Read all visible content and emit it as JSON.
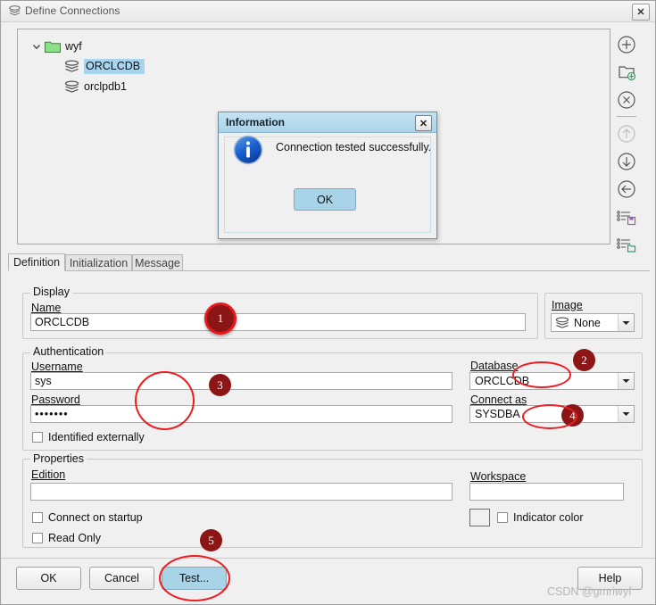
{
  "window": {
    "title": "Define Connections",
    "title_icon": "database-stack-icon",
    "close_label": "✕"
  },
  "tree": {
    "nodes": [
      {
        "label": "wyf",
        "icon": "folder-icon",
        "expander": "chevron-down-icon",
        "selected": false,
        "level": 0
      },
      {
        "label": "ORCLCDB",
        "icon": "database-stack-icon",
        "selected": true,
        "level": 1
      },
      {
        "label": "orclpdb1",
        "icon": "database-stack-icon",
        "selected": false,
        "level": 1
      }
    ]
  },
  "toolbar": {
    "buttons": [
      {
        "name": "add-connection-button",
        "icon": "plus-circle-icon",
        "enabled": true
      },
      {
        "name": "new-folder-button",
        "icon": "folder-add-icon",
        "enabled": true
      },
      {
        "name": "delete-connection-button",
        "icon": "x-circle-icon",
        "enabled": true
      },
      {
        "name": "move-up-button",
        "icon": "arrow-up-circle-icon",
        "enabled": false
      },
      {
        "name": "move-down-button",
        "icon": "arrow-down-circle-icon",
        "enabled": true
      },
      {
        "name": "move-back-button",
        "icon": "arrow-left-circle-icon",
        "enabled": true
      },
      {
        "name": "export-list-button",
        "icon": "list-save-icon",
        "enabled": true
      },
      {
        "name": "import-list-button",
        "icon": "list-open-icon",
        "enabled": true
      }
    ]
  },
  "tabs": [
    {
      "label": "Definition",
      "active": true
    },
    {
      "label": "Initialization",
      "active": false
    },
    {
      "label": "Message",
      "active": false
    }
  ],
  "display_group": {
    "title": "Display",
    "name_label": "Name",
    "name_value": "ORCLCDB",
    "image_label": "Image",
    "image_value": "None",
    "image_icon": "database-stack-icon"
  },
  "authentication_group": {
    "title": "Authentication",
    "username_label": "Username",
    "username_value": "sys",
    "password_label": "Password",
    "password_value": "•••••••",
    "identified_externally_label": "Identified externally",
    "identified_externally_checked": false,
    "database_label": "Database",
    "database_value": "ORCLCDB",
    "connect_as_label": "Connect as",
    "connect_as_value": "SYSDBA"
  },
  "properties_group": {
    "title": "Properties",
    "edition_label": "Edition",
    "edition_value": "",
    "connect_on_startup_label": "Connect on startup",
    "connect_on_startup_checked": false,
    "read_only_label": "Read Only",
    "read_only_checked": false,
    "workspace_label": "Workspace",
    "workspace_value": "",
    "indicator_color_label": "Indicator color",
    "indicator_color_checked": false,
    "indicator_color_swatch": "#f0f0f0"
  },
  "buttons": {
    "ok": "OK",
    "cancel": "Cancel",
    "test": "Test...",
    "help": "Help"
  },
  "modal": {
    "title": "Information",
    "close_label": "✕",
    "message": "Connection tested successfully.",
    "ok_label": "OK",
    "icon": "info-circle-icon"
  },
  "annotations": {
    "badges": [
      {
        "num": "1",
        "ring": true
      },
      {
        "num": "2",
        "ring": false
      },
      {
        "num": "3",
        "ring": false
      },
      {
        "num": "4",
        "ring": false
      },
      {
        "num": "5",
        "ring": false
      }
    ]
  },
  "watermark": "CSDN @gmriwyf",
  "colors": {
    "accent_blue": "#a9d4e8",
    "selection": "#a8d4ee",
    "annotation_red": "#8c1515",
    "ring_red": "#ee1c21",
    "folder_green": "#8de08a"
  }
}
